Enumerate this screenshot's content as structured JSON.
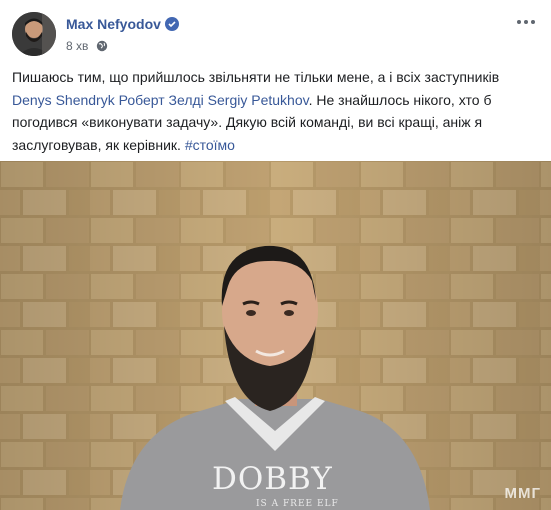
{
  "post": {
    "author_name": "Max Nefyodov",
    "time": "8 хв",
    "text_part1": "Пишаюсь тим, що прийшлось звільняти не тільки мене, а і всіх заступників ",
    "mention1": "Denys Shendryk",
    "text_part2": " ",
    "mention2": "Роберт Зелді",
    "text_part3": " ",
    "mention3": "Sergiy Petukhov",
    "text_part4": ". Не знайшлось нікого, хто б погодився «виконувати задачу». Дякую всій команді, ви всі кращі, аніж я заслуговував, як керівник. ",
    "hashtag": "#стоїмо"
  },
  "photo": {
    "shirt_text": "DOBBY",
    "shirt_subtext": "IS A FREE ELF",
    "watermark": "ММГ"
  },
  "colors": {
    "link": "#385898",
    "text": "#1c1e21",
    "meta": "#606770",
    "verified": "#4267b2"
  }
}
